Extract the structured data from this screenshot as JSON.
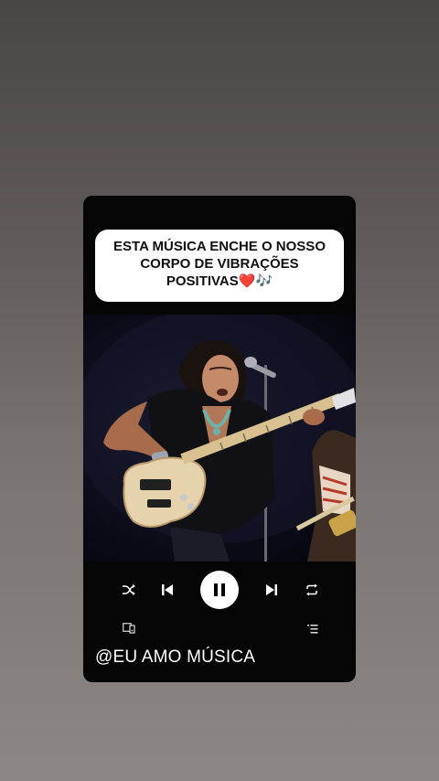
{
  "caption": {
    "line1": "ESTA MÚSICA ENCHE O NOSSO",
    "line2": "CORPO DE VIBRAÇÕES",
    "line3": "POSITIVAS",
    "emoji": "❤️🎶"
  },
  "player": {
    "state": "playing",
    "buttons": [
      "shuffle",
      "previous",
      "pause",
      "next",
      "repeat"
    ],
    "secondary": [
      "connect-device",
      "queue"
    ]
  },
  "footer": {
    "handle": "@EU AMO MÚSICA"
  },
  "colors": {
    "card": "#050505",
    "caption_bg": "#ffffff",
    "icon": "#ffffff"
  }
}
